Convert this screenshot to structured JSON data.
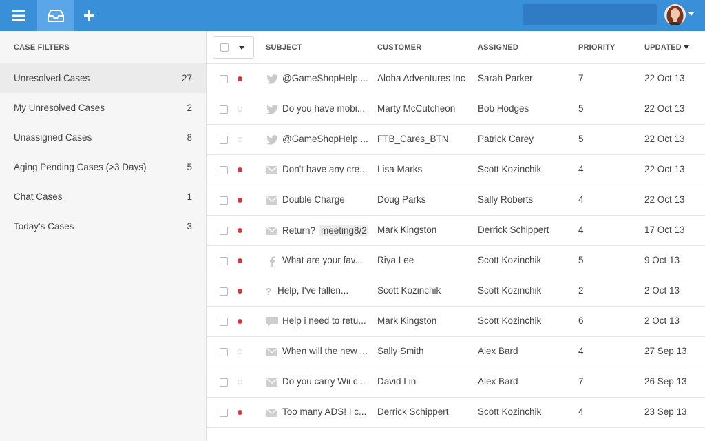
{
  "topbar": {
    "icons": [
      "menu-icon",
      "inbox-icon",
      "plus-icon",
      "user-menu-caret-icon"
    ],
    "colors": {
      "bar": "#3a8fd9",
      "active_tab": "#5aa6e8",
      "search": "#2f7cc4"
    }
  },
  "sidebar": {
    "heading": "CASE FILTERS",
    "items": [
      {
        "label": "Unresolved Cases",
        "count": "27"
      },
      {
        "label": "My Unresolved Cases",
        "count": "2"
      },
      {
        "label": "Unassigned Cases",
        "count": "8"
      },
      {
        "label": "Aging Pending Cases (>3 Days)",
        "count": "5"
      },
      {
        "label": "Chat Cases",
        "count": "1"
      },
      {
        "label": "Today's Cases",
        "count": "3"
      }
    ]
  },
  "table": {
    "columns": {
      "subject": "SUBJECT",
      "customer": "CUSTOMER",
      "assigned": "ASSIGNED",
      "priority": "PRIORITY",
      "updated": "UPDATED"
    },
    "rows": [
      {
        "status": "filled",
        "channel": "twitter-icon",
        "subject": "@GameShopHelp ...",
        "tag": "",
        "customer": "Aloha Adventures Inc",
        "assigned": "Sarah Parker",
        "priority": "7",
        "updated": "22 Oct 13"
      },
      {
        "status": "empty",
        "channel": "twitter-icon",
        "subject": "Do you have mobi...",
        "tag": "",
        "customer": "Marty McCutcheon",
        "assigned": "Bob Hodges",
        "priority": "5",
        "updated": "22 Oct 13"
      },
      {
        "status": "empty",
        "channel": "twitter-icon",
        "subject": "@GameShopHelp ...",
        "tag": "",
        "customer": "FTB_Cares_BTN",
        "assigned": "Patrick Carey",
        "priority": "5",
        "updated": "22 Oct 13"
      },
      {
        "status": "filled",
        "channel": "email-icon",
        "subject": "Don't have any cre...",
        "tag": "",
        "customer": "Lisa Marks",
        "assigned": "Scott Kozinchik",
        "priority": "4",
        "updated": "22 Oct 13"
      },
      {
        "status": "filled",
        "channel": "email-icon",
        "subject": "Double Charge",
        "tag": "",
        "customer": "Doug Parks",
        "assigned": "Sally Roberts",
        "priority": "4",
        "updated": "22 Oct 13"
      },
      {
        "status": "filled",
        "channel": "email-icon",
        "subject": "Return?",
        "tag": "meeting8/2",
        "customer": "Mark Kingston",
        "assigned": "Derrick Schippert",
        "priority": "4",
        "updated": "17 Oct 13"
      },
      {
        "status": "filled",
        "channel": "facebook-icon",
        "subject": "What are your fav...",
        "tag": "",
        "customer": "Riya Lee",
        "assigned": "Scott Kozinchik",
        "priority": "5",
        "updated": "9 Oct 13"
      },
      {
        "status": "filled",
        "channel": "question-icon",
        "subject": "Help, I've fallen...",
        "tag": "",
        "customer": "Scott Kozinchik",
        "assigned": "Scott Kozinchik",
        "priority": "2",
        "updated": "2 Oct 13"
      },
      {
        "status": "filled",
        "channel": "chat-icon",
        "subject": "Help i need to retu...",
        "tag": "",
        "customer": "Mark Kingston",
        "assigned": "Scott Kozinchik",
        "priority": "6",
        "updated": "2 Oct 13"
      },
      {
        "status": "empty",
        "channel": "email-icon",
        "subject": "When will the new ...",
        "tag": "",
        "customer": "Sally Smith",
        "assigned": "Alex Bard",
        "priority": "4",
        "updated": "27 Sep 13"
      },
      {
        "status": "empty",
        "channel": "email-icon",
        "subject": "Do you carry Wii c...",
        "tag": "",
        "customer": "David Lin",
        "assigned": "Alex Bard",
        "priority": "7",
        "updated": "26 Sep 13"
      },
      {
        "status": "filled",
        "channel": "email-icon",
        "subject": "Too many ADS! I c...",
        "tag": "",
        "customer": "Derrick Schippert",
        "assigned": "Scott Kozinchik",
        "priority": "4",
        "updated": "23 Sep 13"
      }
    ]
  }
}
